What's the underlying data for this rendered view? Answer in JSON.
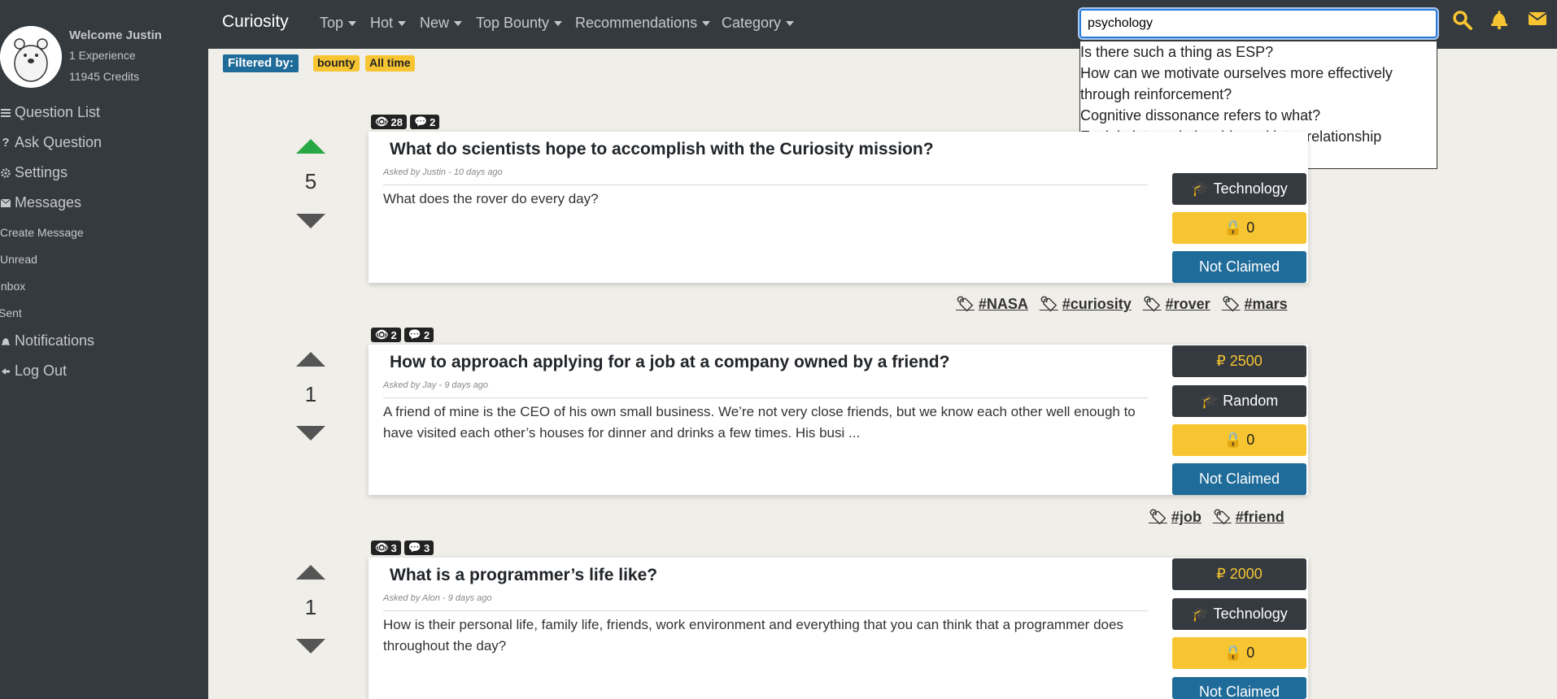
{
  "profile": {
    "welcome": "Welcome Justin",
    "experience": "1 Experience",
    "credits": "11945 Credits"
  },
  "sidebar": {
    "items": [
      {
        "label": "Question List",
        "icon": "list-icon"
      },
      {
        "label": "Ask Question",
        "icon": "question-icon"
      },
      {
        "label": "Settings",
        "icon": "gear-icon"
      },
      {
        "label": "Messages",
        "icon": "envelope-icon"
      }
    ],
    "message_sub": [
      "Create Message",
      "Unread",
      "Inbox",
      "Sent"
    ],
    "bottom_items": [
      {
        "label": "Notifications",
        "icon": "bell-icon"
      },
      {
        "label": "Log Out",
        "icon": "logout-icon"
      }
    ]
  },
  "topbar": {
    "brand": "Curiosity",
    "menus": [
      "Top",
      "Hot",
      "New",
      "Top Bounty",
      "Recommendations",
      "Category"
    ],
    "search_value": "psychology"
  },
  "suggestions": [
    "Is there such a thing as ESP?",
    "How can we motivate ourselves more effectively through reinforcement?",
    "Cognitive dissonance refers to what?",
    "Explain inter-relationship and intra-relationship according to psychology."
  ],
  "filter": {
    "label": "Filtered by:",
    "chips": [
      "bounty",
      "All time"
    ]
  },
  "questions": [
    {
      "votes": "5",
      "views": "28",
      "comments": "2",
      "title": "What do scientists hope to accomplish with the Curiosity mission?",
      "asked": "Asked by Justin - 10 days ago",
      "body": "What does the rover do every day?",
      "bounty": "",
      "category": "Technology",
      "locks": "0",
      "status": "Not Claimed",
      "tags": [
        "#NASA",
        "#curiosity",
        "#rover",
        "#mars"
      ]
    },
    {
      "votes": "1",
      "views": "2",
      "comments": "2",
      "title": "How to approach applying for a job at a company owned by a friend?",
      "asked": "Asked by Jay - 9 days ago",
      "body": "A friend of mine is the CEO of his own small business. We’re not very close friends, but we know each other well enough to have visited each other’s houses for dinner and drinks a few times. His busi ...",
      "bounty": "₽ 2500",
      "category": "Random",
      "locks": "0",
      "status": "Not Claimed",
      "tags": [
        "#job",
        "#friend"
      ]
    },
    {
      "votes": "1",
      "views": "3",
      "comments": "3",
      "title": "What is a programmer’s life like?",
      "asked": "Asked by Alon - 9 days ago",
      "body": "How is their personal life, family life, friends, work environment and everything that you can think that a programmer does throughout the day?",
      "bounty": "₽ 2000",
      "category": "Technology",
      "locks": "0",
      "status": "Not Claimed",
      "tags": []
    }
  ],
  "colors": {
    "accent_blue": "#1f6b99",
    "bounty_yellow": "#f7c531",
    "sidebar_bg": "#353a3e",
    "upvote_green": "#28a745"
  }
}
